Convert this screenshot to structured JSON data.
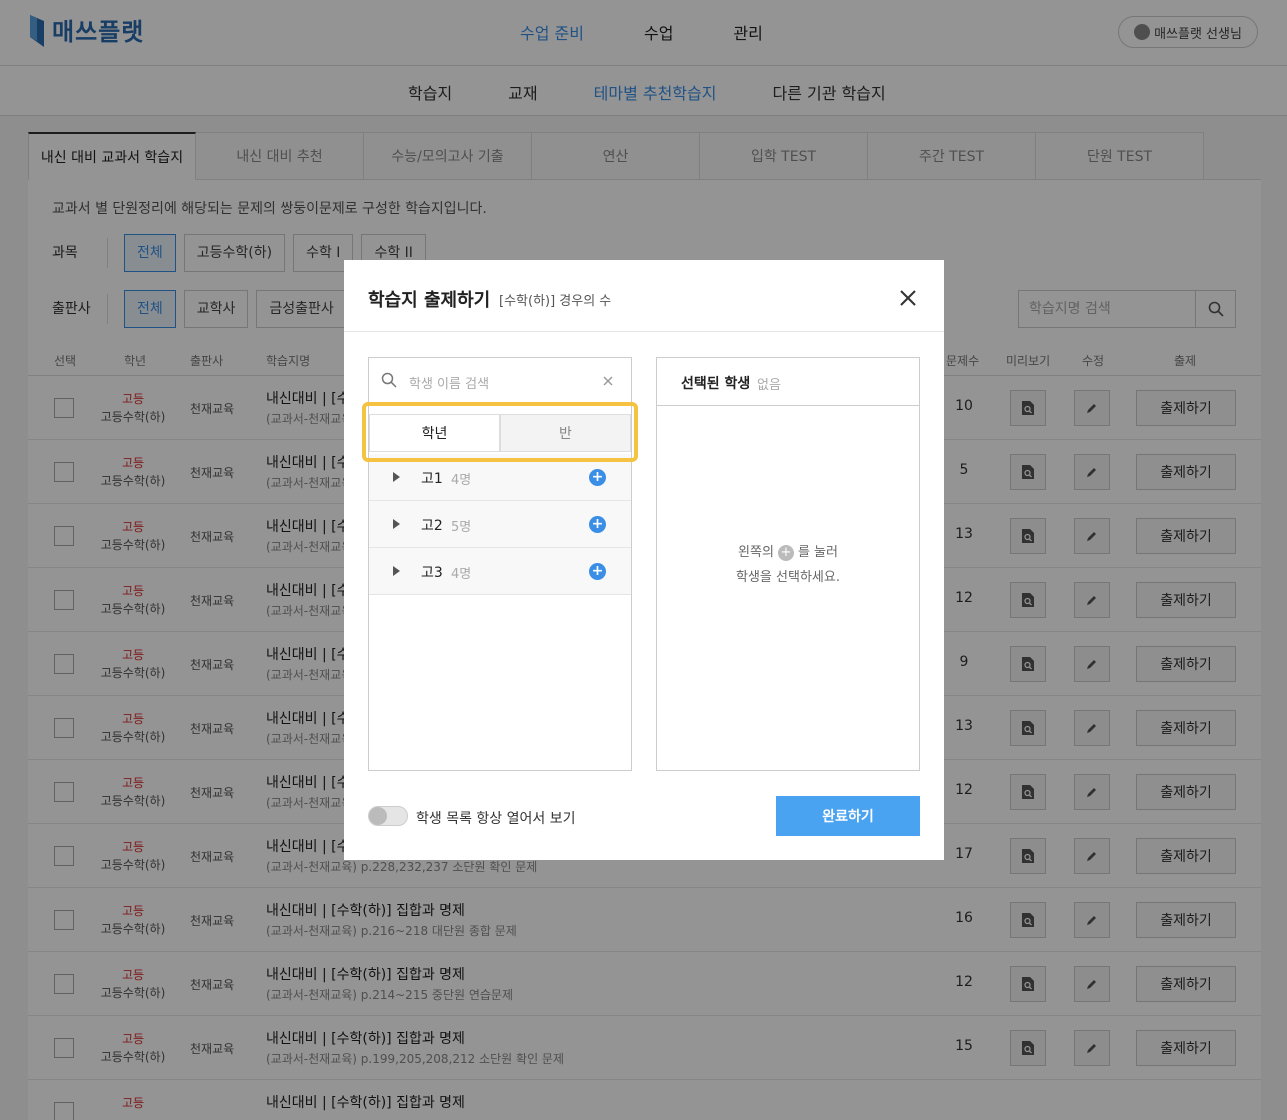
{
  "header": {
    "logo_text": "매쓰플랫",
    "nav": [
      {
        "label": "수업 준비",
        "active": true
      },
      {
        "label": "수업",
        "active": false
      },
      {
        "label": "관리",
        "active": false
      }
    ],
    "user_label": "매쓰플랫 선생님"
  },
  "subnav": [
    {
      "label": "학습지",
      "active": false
    },
    {
      "label": "교재",
      "active": false
    },
    {
      "label": "테마별 추천학습지",
      "active": true
    },
    {
      "label": "다른 기관 학습지",
      "active": false
    }
  ],
  "tabs": [
    "내신 대비 교과서 학습지",
    "내신 대비 추천",
    "수능/모의고사 기출",
    "연산",
    "입학 TEST",
    "주간 TEST",
    "단원 TEST"
  ],
  "description": "교과서 별 단원정리에 해당되는 문제의 쌍둥이문제로 구성한 학습지입니다.",
  "filters": {
    "subject_label": "과목",
    "subject_chips": [
      "전체",
      "고등수학(하)",
      "수학 I",
      "수학 II"
    ],
    "publisher_label": "출판사",
    "publisher_chips": [
      "전체",
      "교학사",
      "금성출판사"
    ]
  },
  "search_placeholder": "학습지명 검색",
  "table": {
    "headers": [
      "선택",
      "학년",
      "출판사",
      "학습지명",
      "문제수",
      "미리보기",
      "수정",
      "출제"
    ],
    "rows": [
      {
        "level": "고등",
        "grade": "고등수학(하)",
        "publisher": "천재교육",
        "title": "내신대비 | [수",
        "sub": "(교과서-천재교육",
        "count": "10",
        "action": "출제하기"
      },
      {
        "level": "고등",
        "grade": "고등수학(하)",
        "publisher": "천재교육",
        "title": "내신대비 | [수",
        "sub": "(교과서-천재교육",
        "count": "5",
        "action": "출제하기"
      },
      {
        "level": "고등",
        "grade": "고등수학(하)",
        "publisher": "천재교육",
        "title": "내신대비 | [수",
        "sub": "(교과서-천재교육",
        "count": "13",
        "action": "출제하기"
      },
      {
        "level": "고등",
        "grade": "고등수학(하)",
        "publisher": "천재교육",
        "title": "내신대비 | [수",
        "sub": "(교과서-천재교육",
        "count": "12",
        "action": "출제하기"
      },
      {
        "level": "고등",
        "grade": "고등수학(하)",
        "publisher": "천재교육",
        "title": "내신대비 | [수",
        "sub": "(교과서-천재교육",
        "count": "9",
        "action": "출제하기"
      },
      {
        "level": "고등",
        "grade": "고등수학(하)",
        "publisher": "천재교육",
        "title": "내신대비 | [수",
        "sub": "(교과서-천재교육",
        "count": "13",
        "action": "출제하기"
      },
      {
        "level": "고등",
        "grade": "고등수학(하)",
        "publisher": "천재교육",
        "title": "내신대비 | [수",
        "sub": "(교과서-천재교육",
        "count": "12",
        "action": "출제하기"
      },
      {
        "level": "고등",
        "grade": "고등수학(하)",
        "publisher": "천재교육",
        "title": "내신대비 | [수",
        "sub": "(교과서-천재교육) p.228,232,237 소단원 확인 문제",
        "count": "17",
        "action": "출제하기"
      },
      {
        "level": "고등",
        "grade": "고등수학(하)",
        "publisher": "천재교육",
        "title": "내신대비 | [수학(하)] 집합과 명제",
        "sub": "(교과서-천재교육) p.216~218 대단원 종합 문제",
        "count": "16",
        "action": "출제하기"
      },
      {
        "level": "고등",
        "grade": "고등수학(하)",
        "publisher": "천재교육",
        "title": "내신대비 | [수학(하)] 집합과 명제",
        "sub": "(교과서-천재교육) p.214~215 중단원 연습문제",
        "count": "12",
        "action": "출제하기"
      },
      {
        "level": "고등",
        "grade": "고등수학(하)",
        "publisher": "천재교육",
        "title": "내신대비 | [수학(하)] 집합과 명제",
        "sub": "(교과서-천재교육) p.199,205,208,212 소단원 확인 문제",
        "count": "15",
        "action": "출제하기"
      },
      {
        "level": "고등",
        "grade": "",
        "publisher": "",
        "title": "내신대비 | [수학(하)] 집합과 명제",
        "sub": "",
        "count": "",
        "action": ""
      }
    ]
  },
  "modal": {
    "title": "학습지 출제하기",
    "subtitle": "[수학(하)] 경우의 수",
    "student_search_placeholder": "학생 이름 검색",
    "segment": [
      {
        "label": "학년",
        "active": true
      },
      {
        "label": "반",
        "active": false
      }
    ],
    "grades": [
      {
        "name": "고1",
        "count": "4명"
      },
      {
        "name": "고2",
        "count": "5명"
      },
      {
        "name": "고3",
        "count": "4명"
      }
    ],
    "selected_title": "선택된 학생",
    "selected_none": "없음",
    "hint_line1_a": "왼쪽의",
    "hint_line1_b": "를 눌러",
    "hint_line2": "학생을 선택하세요.",
    "toggle_label": "학생 목록 항상 열어서 보기",
    "done_label": "완료하기"
  },
  "colors": {
    "accent": "#3a8ee6",
    "highlight": "#f5c242",
    "done": "#4aa3f0"
  }
}
